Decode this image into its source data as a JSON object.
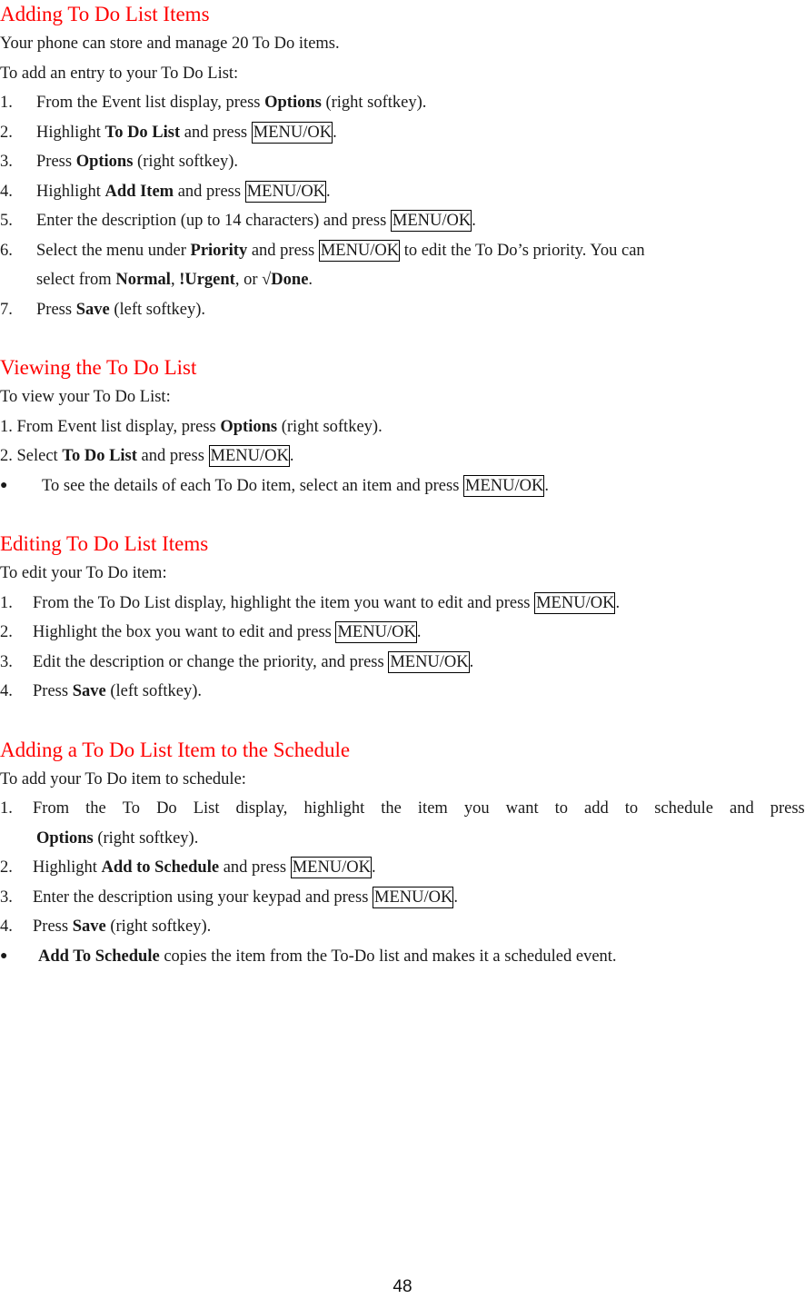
{
  "sections": {
    "adding": {
      "heading": "Adding To Do List Items",
      "intro1": "Your phone can store and manage 20 To Do items.",
      "intro2": "To add an entry to your To Do List:",
      "steps": [
        {
          "num": "1.",
          "pre": "From the Event list display, press ",
          "bold": "Options",
          "post": " (right softkey)."
        },
        {
          "num": "2.",
          "pre": "Highlight ",
          "bold": "To Do List",
          "mid": " and press ",
          "key": "MENU/OK",
          "post": "."
        },
        {
          "num": "3.",
          "pre": "Press ",
          "bold": "Options",
          "post": " (right softkey)."
        },
        {
          "num": "4.",
          "pre": "Highlight ",
          "bold": "Add Item",
          "mid": " and press ",
          "key": "MENU/OK",
          "post": "."
        },
        {
          "num": "5.",
          "pre": "Enter the description (up to 14 characters) and press ",
          "key": "MENU/OK",
          "post": "."
        },
        {
          "num": "6.",
          "pre": "Select the menu under ",
          "bold": "Priority",
          "mid": " and press ",
          "key": "MENU/OK",
          "post": " to edit the To Do’s priority. You can",
          "cont_pre": "select from ",
          "opt1": "Normal",
          "sep1": ", ",
          "opt2": "!Urgent",
          "sep2": ", or ",
          "opt3": "√Done",
          "cont_post": "."
        },
        {
          "num": "7.",
          "pre": "Press ",
          "bold": "Save",
          "post": " (left softkey)."
        }
      ]
    },
    "viewing": {
      "heading": "Viewing the To Do List",
      "intro": "To view your To Do List:",
      "step1": {
        "pre": "1. From Event list display, press ",
        "bold": "Options",
        "post": " (right softkey)."
      },
      "step2": {
        "pre": "2. Select ",
        "bold": "To Do List",
        "mid": " and press ",
        "key": "MENU/OK",
        "post": "."
      },
      "bullet": {
        "symbol": "●",
        "pre": "To see the details of each To Do item, select an item and press ",
        "key": "MENU/OK",
        "post": "."
      }
    },
    "editing": {
      "heading": "Editing To Do List Items",
      "intro": "To edit your To Do item:",
      "steps": [
        {
          "num": "1.",
          "pre": "From the To Do List display, highlight the item you want to edit and press ",
          "key": "MENU/OK",
          "post": "."
        },
        {
          "num": "2.",
          "pre": "Highlight the box you want to edit and press ",
          "key": "MENU/OK",
          "post": "."
        },
        {
          "num": "3.",
          "pre": "Edit the description or change the priority, and press ",
          "key": "MENU/OK",
          "post": "."
        },
        {
          "num": "4.",
          "pre": "Press ",
          "bold": "Save",
          "post": " (left softkey)."
        }
      ]
    },
    "schedule": {
      "heading": "Adding a To Do List Item to the Schedule",
      "intro": "To add your To Do item to schedule:",
      "step1": {
        "num": "1.",
        "words": [
          "From",
          "the",
          "To",
          "Do",
          "List",
          "display,",
          "highlight",
          "the",
          "item",
          "you",
          "want",
          "to",
          "add",
          "to",
          "schedule",
          "and",
          "press"
        ],
        "cont_bold": "Options",
        "cont_post": " (right softkey)."
      },
      "step2": {
        "num": "2.",
        "pre": "Highlight ",
        "bold": "Add to Schedule",
        "mid": " and press ",
        "key": "MENU/OK",
        "post": "."
      },
      "step3": {
        "num": "3.",
        "pre": "Enter the description using your keypad and press ",
        "key": "MENU/OK",
        "post": "."
      },
      "step4": {
        "num": "4.",
        "pre": "Press ",
        "bold": "Save",
        "post": " (right softkey)."
      },
      "bullet": {
        "symbol": "●",
        "bold": "Add To Schedule",
        "post": " copies the item from the To-Do list and makes it a scheduled event."
      }
    }
  },
  "footer": {
    "page_number": "48"
  }
}
